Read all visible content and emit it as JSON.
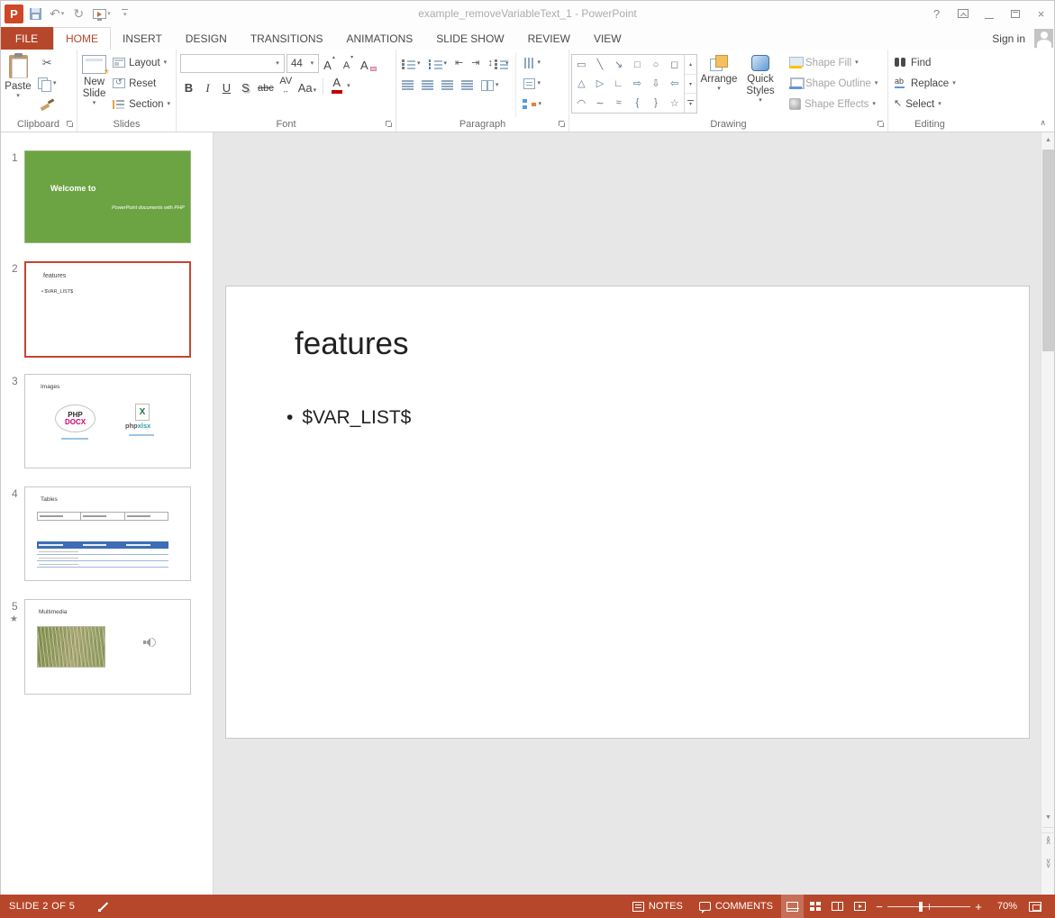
{
  "icons": {
    "dropdown": "▾",
    "undo": "↶",
    "redo": "↻",
    "cut": "✂",
    "collapse": "∧",
    "scroll_up": "▲",
    "scroll_down": "▼",
    "tri_up": "▴",
    "tri_down": "▾",
    "outdent": "⇤",
    "indent": "⇥",
    "line_spacing": "↕",
    "select_arrow": "↖",
    "animation_star": "★",
    "close": "×",
    "chevron_up": "∧",
    "chevron_down": "∨"
  },
  "titlebar": {
    "title": "example_removeVariableText_1 - PowerPoint",
    "help": "?"
  },
  "tabs": {
    "file": "FILE",
    "home": "HOME",
    "insert": "INSERT",
    "design": "DESIGN",
    "transitions": "TRANSITIONS",
    "animations": "ANIMATIONS",
    "slide_show": "SLIDE SHOW",
    "review": "REVIEW",
    "view": "VIEW",
    "sign_in": "Sign in"
  },
  "ribbon": {
    "clipboard": {
      "group_label": "Clipboard",
      "paste": "Paste"
    },
    "slides": {
      "group_label": "Slides",
      "new_slide": "New Slide",
      "layout": "Layout",
      "reset": "Reset",
      "section": "Section"
    },
    "font": {
      "group_label": "Font",
      "font_name_value": "",
      "size_value": "44",
      "grow_letter": "A",
      "shrink_letter": "A",
      "clear_letter": "A",
      "bold": "B",
      "italic": "I",
      "underline": "U",
      "shadow": "S",
      "strikethrough": "abc",
      "char_spacing": "AV",
      "char_spacing_arrow": "↔",
      "change_case": "Aa",
      "font_color_letter": "A"
    },
    "paragraph": {
      "group_label": "Paragraph"
    },
    "drawing": {
      "group_label": "Drawing",
      "arrange": "Arrange",
      "quick_styles": "Quick Styles",
      "shape_fill": "Shape Fill",
      "shape_outline": "Shape Outline",
      "shape_effects": "Shape Effects",
      "shapes_row1": [
        "▭",
        "╲",
        "↘",
        "□",
        "○",
        "◻"
      ],
      "shapes_row2": [
        "△",
        "▷",
        "∟",
        "⇨",
        "⇩",
        "⇦"
      ],
      "shapes_row3": [
        "◠",
        "∼",
        "≈",
        "{",
        "}",
        "☆"
      ]
    },
    "editing": {
      "group_label": "Editing",
      "find": "Find",
      "replace": "Replace",
      "select": "Select"
    }
  },
  "thumbnails": {
    "slide1": {
      "number": "1",
      "title": "Welcome to",
      "subtitle": "PowerPoint documents with PHP"
    },
    "slide2": {
      "number": "2",
      "title": "features",
      "bullet": "• $VAR_LIST$"
    },
    "slide3": {
      "number": "3",
      "title": "Images",
      "logo1_line1": "PHP",
      "logo1_line2": "DOCX",
      "logo2_x": "X",
      "logo2_php": "php",
      "logo2_xlsx": "xlsx"
    },
    "slide4": {
      "number": "4",
      "title": "Tables"
    },
    "slide5": {
      "number": "5",
      "title": "Multimedia"
    }
  },
  "slide": {
    "title": "features",
    "bullet_marker": "•",
    "bullet_text": "$VAR_LIST$"
  },
  "statusbar": {
    "slide_info": "SLIDE 2 OF 5",
    "notes": "NOTES",
    "comments": "COMMENTS",
    "zoom_value": "70%"
  }
}
